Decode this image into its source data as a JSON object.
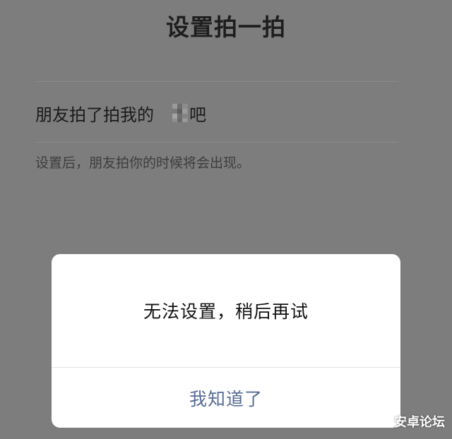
{
  "header": {
    "title": "设置拍一拍"
  },
  "pat_setting": {
    "prefix": "朋友拍了拍我的",
    "suffix": "吧",
    "hint": "设置后，朋友拍你的时候将会出现。"
  },
  "dialog": {
    "message": "无法设置，稍后再试",
    "button_label": "我知道了",
    "button_color": "#576b95"
  },
  "watermark": {
    "text": "安卓论坛"
  }
}
